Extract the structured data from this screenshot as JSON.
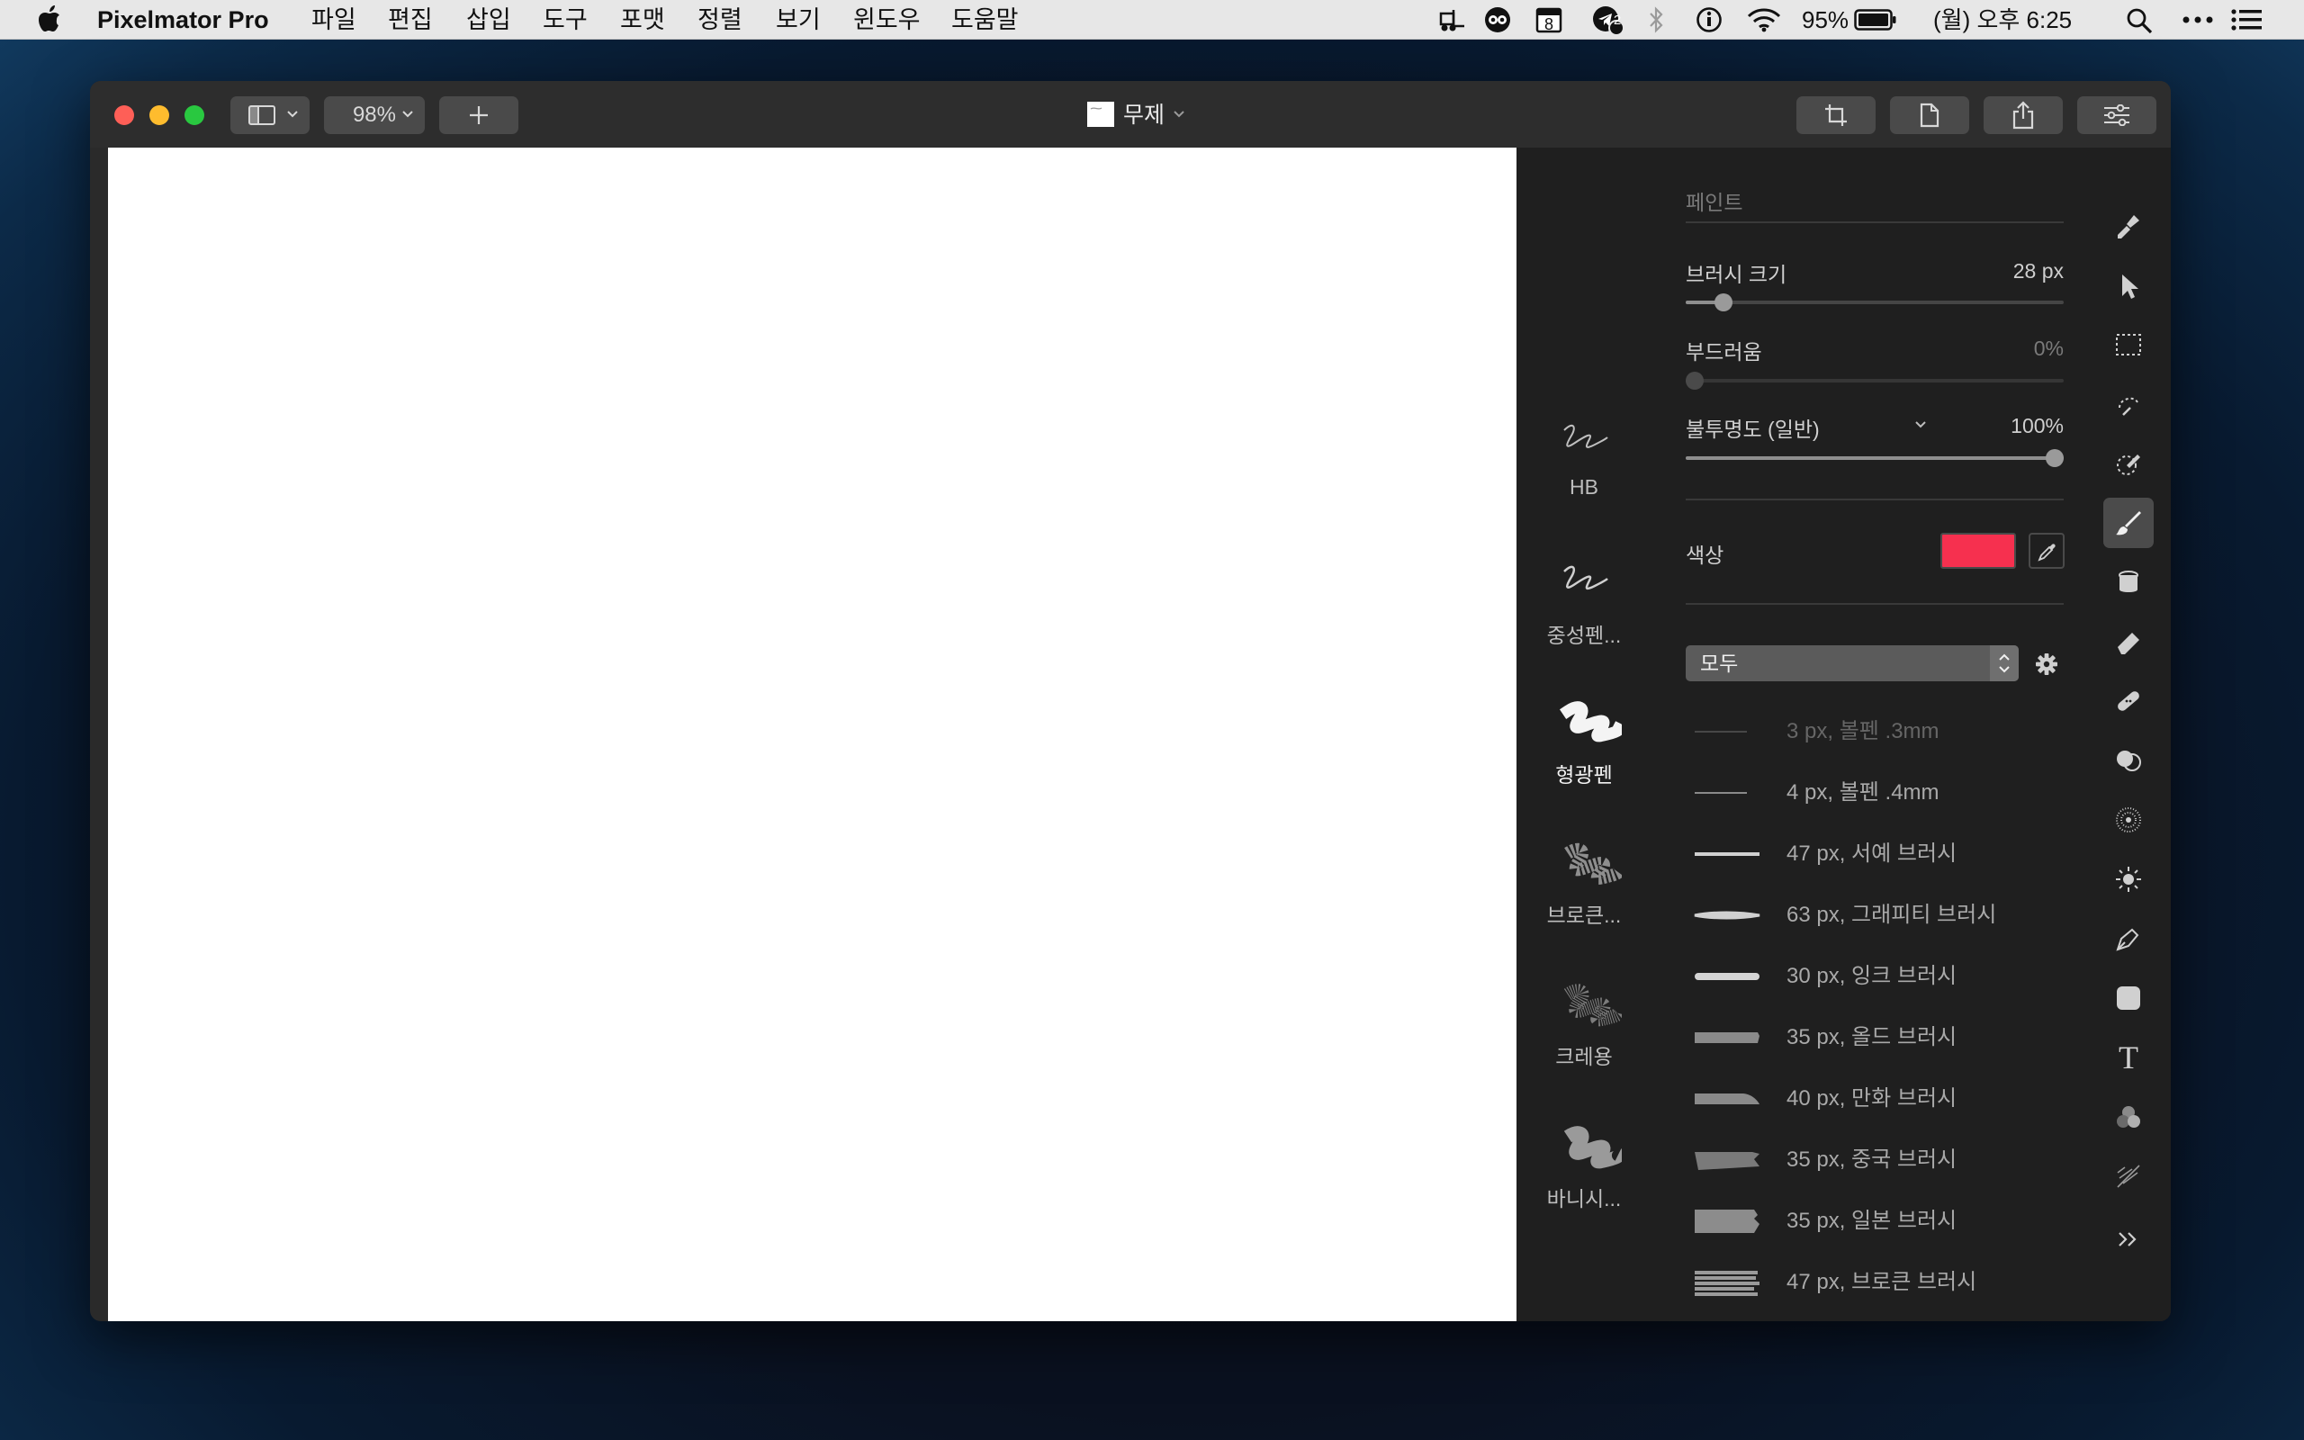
{
  "menubar": {
    "apple_icon": "apple-icon",
    "app_name": "Pixelmator Pro",
    "menus": [
      "파일",
      "편집",
      "삽입",
      "도구",
      "포맷",
      "정렬",
      "보기",
      "윈도우",
      "도움말"
    ],
    "calendar_day": "8",
    "notification_count": "2",
    "battery": "95%",
    "datetime": "(월) 오후 6:25"
  },
  "window": {
    "zoom": "98%",
    "document_title": "무제"
  },
  "brush_presets": [
    {
      "label": "HB"
    },
    {
      "label": "중성펜..."
    },
    {
      "label": "형광펜"
    },
    {
      "label": "브로큰..."
    },
    {
      "label": "크레용"
    },
    {
      "label": "바니시..."
    }
  ],
  "settings": {
    "section_title": "페인트",
    "brush_size_label": "브러시 크기",
    "brush_size_value": "28 px",
    "brush_size_level": 0.08,
    "softness_label": "부드러움",
    "softness_value": "0%",
    "softness_level": 0,
    "opacity_label": "불투명도 (일반)",
    "opacity_value": "100%",
    "opacity_level": 1.0,
    "color_label": "색상",
    "color_swatch": "#f6304f",
    "category_select": "모두"
  },
  "brushes": [
    {
      "label": "3 px, 볼펜 .3mm"
    },
    {
      "label": "4 px, 볼펜 .4mm"
    },
    {
      "label": "47 px, 서예 브러시"
    },
    {
      "label": "63 px, 그래피티 브러시"
    },
    {
      "label": "30 px, 잉크 브러시"
    },
    {
      "label": "35 px, 올드 브러시"
    },
    {
      "label": "40 px, 만화 브러시"
    },
    {
      "label": "35 px, 중국 브러시"
    },
    {
      "label": "35 px, 일본 브러시"
    },
    {
      "label": "47 px, 브로큰 브러시"
    }
  ],
  "tools": [
    "style-tool-icon",
    "arrange-tool-icon",
    "rect-select-icon",
    "magic-select-icon",
    "color-adjust-icon",
    "paint-brush-icon",
    "paint-bucket-icon",
    "erase-icon",
    "repair-icon",
    "clone-icon",
    "distort-icon",
    "effects-icon",
    "pen-icon",
    "shape-icon",
    "type-icon",
    "color-picker-icon",
    "slice-icon",
    "more-tools-icon"
  ],
  "text_tool_glyph": "T"
}
